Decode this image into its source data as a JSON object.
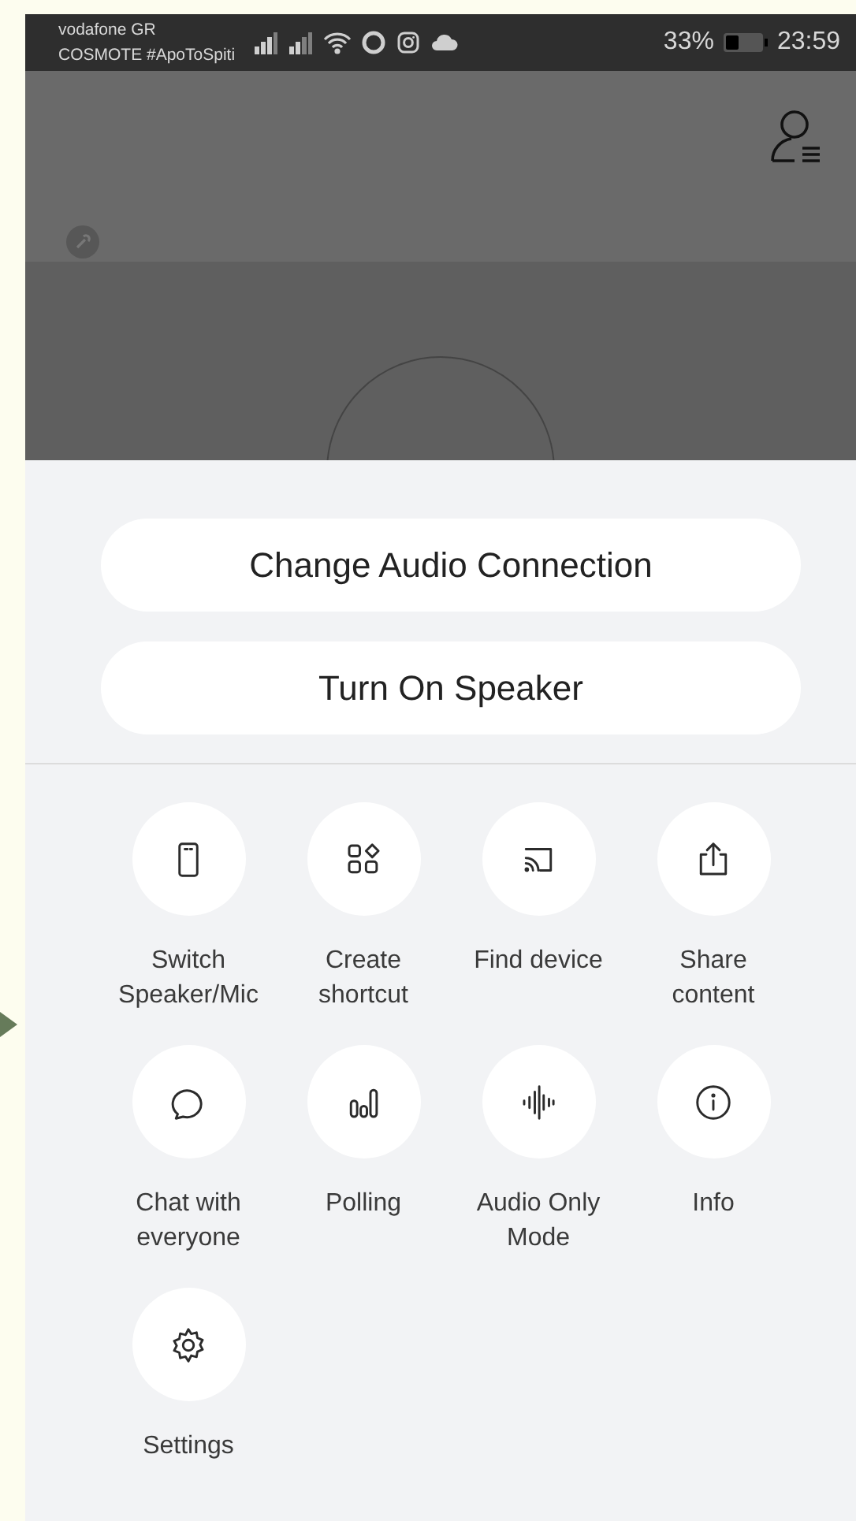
{
  "status_bar": {
    "carrier_1": "vodafone GR",
    "carrier_2": "COSMOTE #ApoToSpiti",
    "battery_text": "33%",
    "time": "23:59"
  },
  "action_sheet": {
    "buttons": [
      "Change Audio Connection",
      "Turn On Speaker"
    ],
    "actions": [
      {
        "kind": "phone",
        "label": "Switch Speaker/Mic"
      },
      {
        "kind": "shortcut",
        "label": "Create shortcut"
      },
      {
        "kind": "cast",
        "label": "Find device"
      },
      {
        "kind": "share",
        "label": "Share content"
      },
      {
        "kind": "chat",
        "label": "Chat with everyone"
      },
      {
        "kind": "poll",
        "label": "Polling"
      },
      {
        "kind": "audio",
        "label": "Audio Only Mode"
      },
      {
        "kind": "info",
        "label": "Info"
      },
      {
        "kind": "settings",
        "label": "Settings"
      }
    ]
  }
}
